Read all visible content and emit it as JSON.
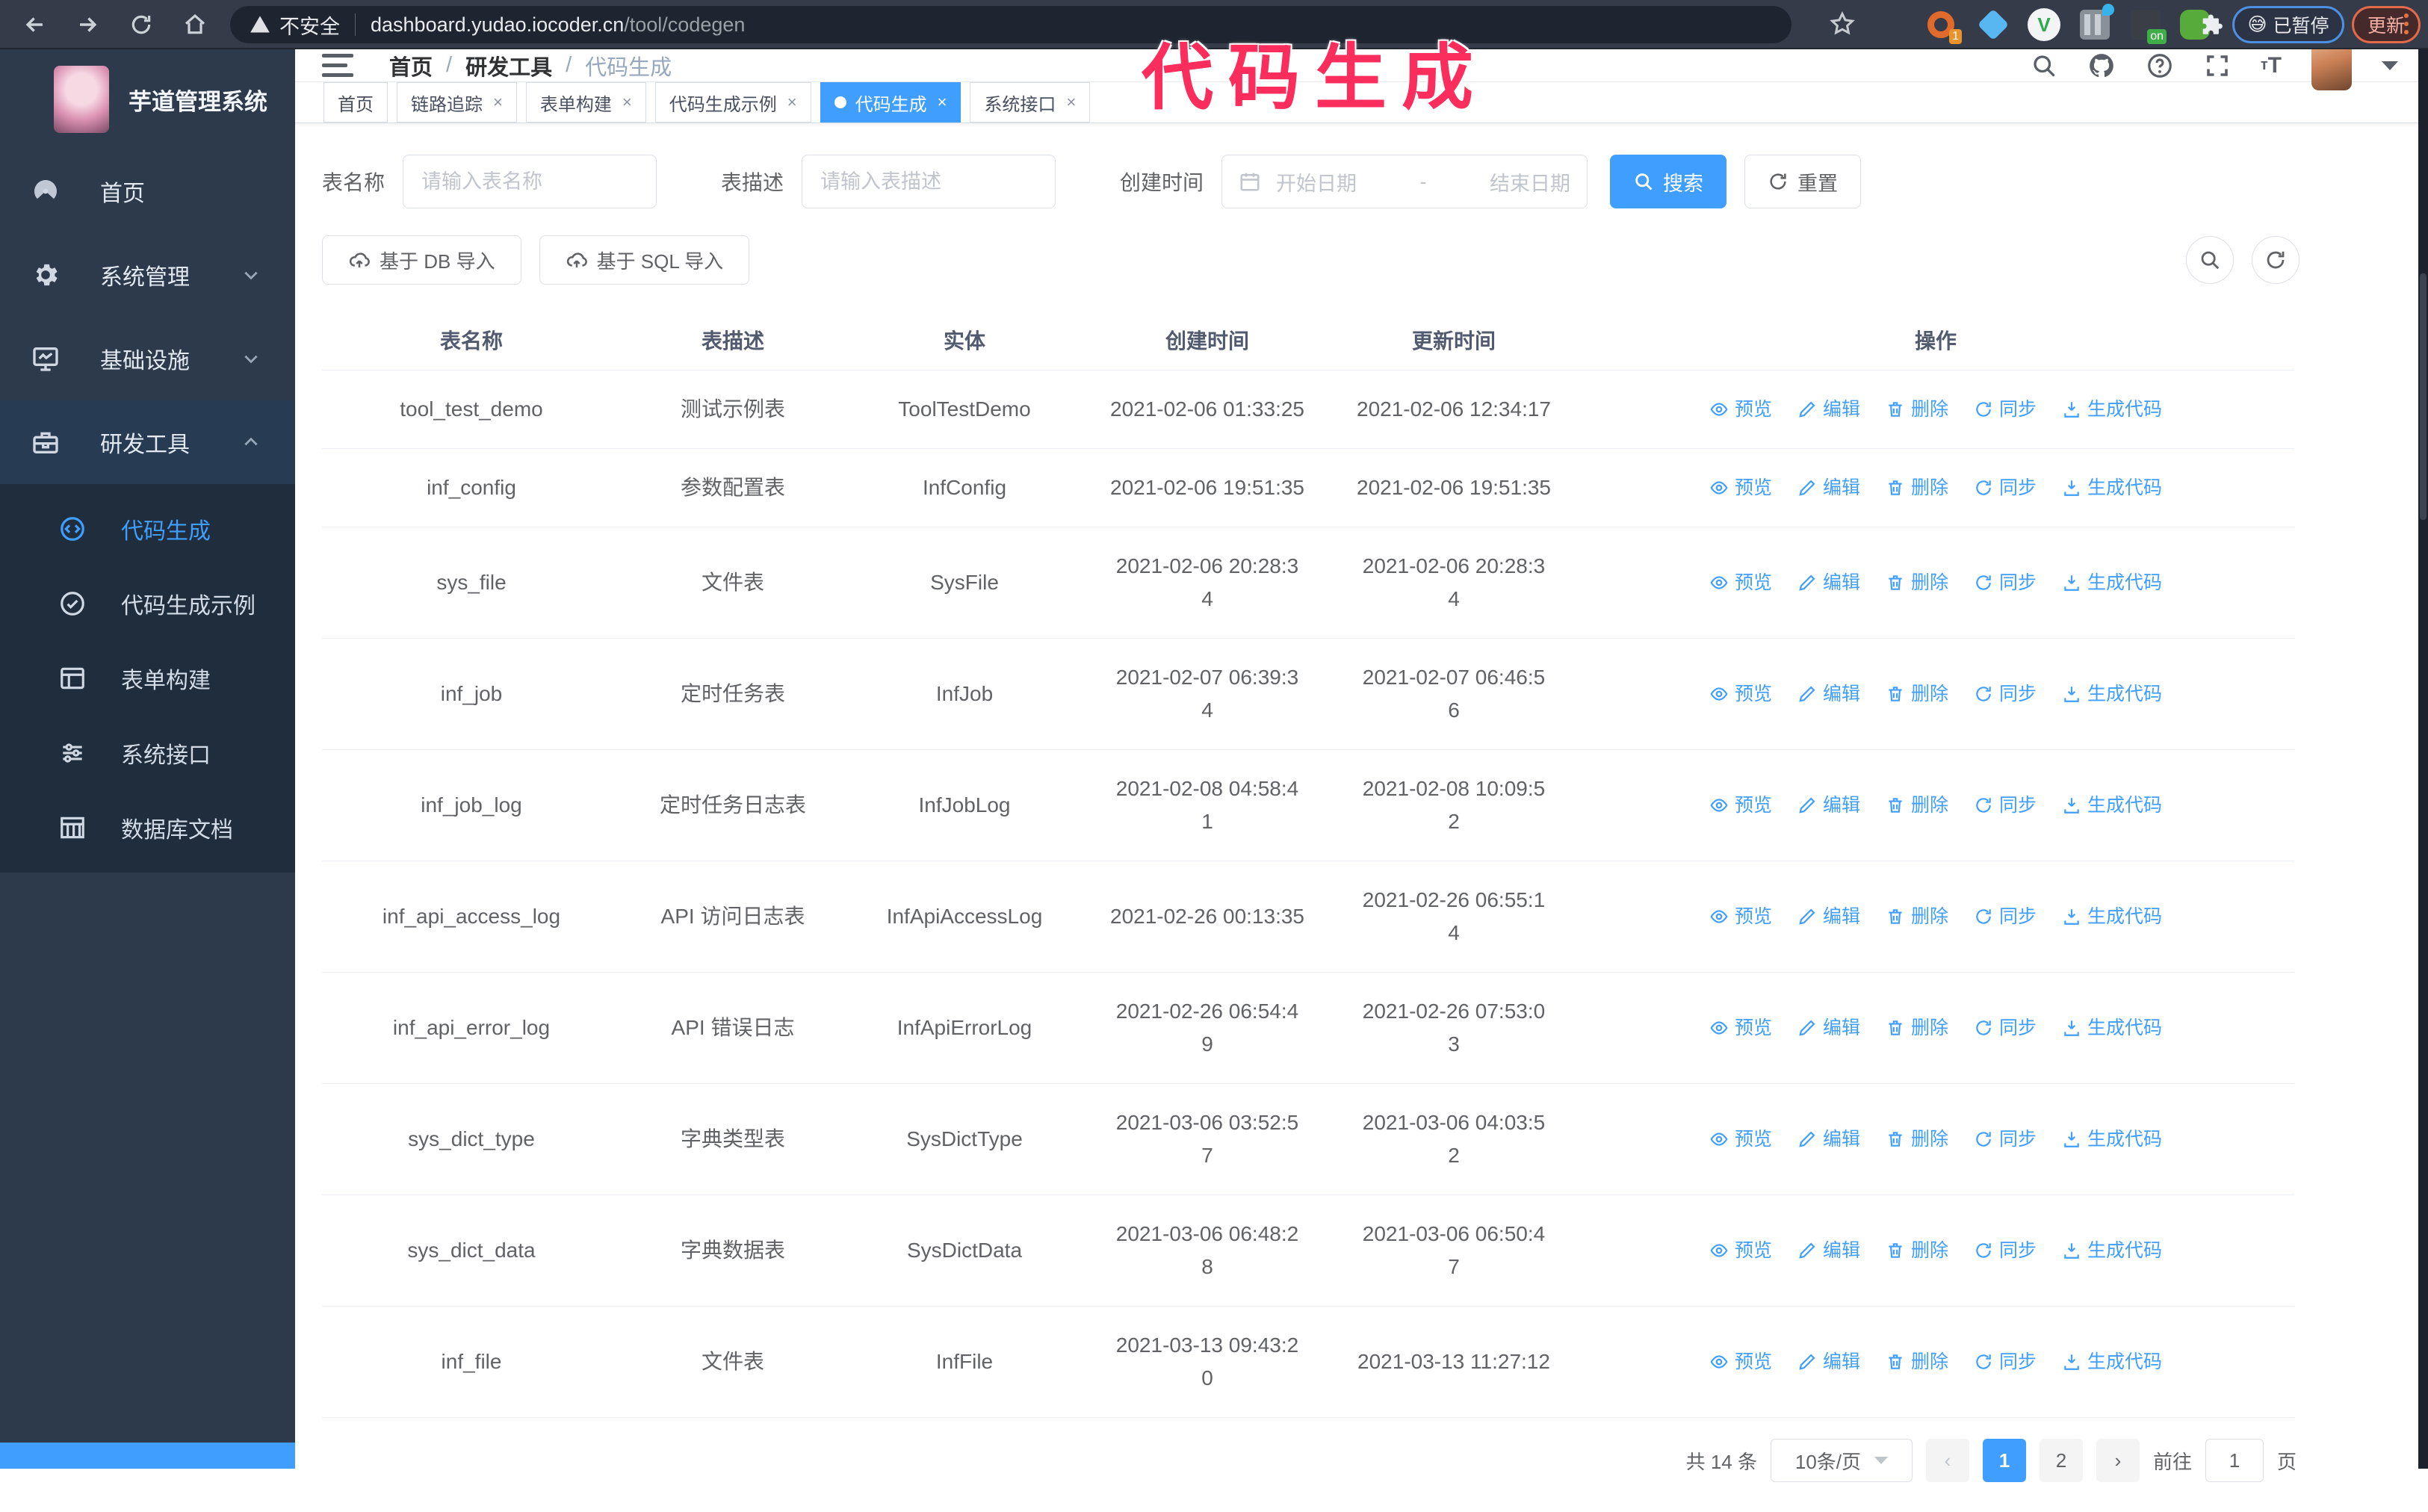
{
  "browser": {
    "security_label": "不安全",
    "url_domain": "dashboard.yudao.iocoder.cn",
    "url_path": "/tool/codegen",
    "extension_badge": "1",
    "extension_on_badge": "on",
    "paused_badge_emoji": "😅",
    "paused_badge": "已暂停",
    "update_button": "更新"
  },
  "annotation": {
    "title": "代码生成",
    "color": "#fb2d5c"
  },
  "sidebar": {
    "app_title": "芋道管理系统",
    "items": [
      {
        "label": "首页"
      },
      {
        "label": "系统管理"
      },
      {
        "label": "基础设施"
      },
      {
        "label": "研发工具"
      }
    ],
    "submenu": [
      {
        "label": "代码生成",
        "active": true
      },
      {
        "label": "代码生成示例"
      },
      {
        "label": "表单构建"
      },
      {
        "label": "系统接口"
      },
      {
        "label": "数据库文档"
      }
    ]
  },
  "header": {
    "breadcrumb": [
      "首页",
      "研发工具",
      "代码生成"
    ]
  },
  "tabs": [
    {
      "label": "首页",
      "closable": false,
      "active": false
    },
    {
      "label": "链路追踪",
      "closable": true,
      "active": false
    },
    {
      "label": "表单构建",
      "closable": true,
      "active": false
    },
    {
      "label": "代码生成示例",
      "closable": true,
      "active": false
    },
    {
      "label": "代码生成",
      "closable": true,
      "active": true
    },
    {
      "label": "系统接口",
      "closable": true,
      "active": false
    }
  ],
  "filters": {
    "table_name_label": "表名称",
    "table_name_placeholder": "请输入表名称",
    "table_desc_label": "表描述",
    "table_desc_placeholder": "请输入表描述",
    "create_time_label": "创建时间",
    "date_start_placeholder": "开始日期",
    "date_separator": "-",
    "date_end_placeholder": "结束日期",
    "search_label": "搜索",
    "reset_label": "重置"
  },
  "toolbar": {
    "import_db_label": "基于 DB 导入",
    "import_sql_label": "基于 SQL 导入"
  },
  "table": {
    "columns": [
      "表名称",
      "表描述",
      "实体",
      "创建时间",
      "更新时间",
      "操作"
    ],
    "actions": [
      "预览",
      "编辑",
      "删除",
      "同步",
      "生成代码"
    ],
    "rows": [
      {
        "name": "tool_test_demo",
        "desc": "测试示例表",
        "entity": "ToolTestDemo",
        "created": "2021-02-06 01:33:25",
        "updated": "2021-02-06 12:34:17"
      },
      {
        "name": "inf_config",
        "desc": "参数配置表",
        "entity": "InfConfig",
        "created": "2021-02-06 19:51:35",
        "updated": "2021-02-06 19:51:35"
      },
      {
        "name": "sys_file",
        "desc": "文件表",
        "entity": "SysFile",
        "created": "2021-02-06 20:28:3\n4",
        "updated": "2021-02-06 20:28:3\n4"
      },
      {
        "name": "inf_job",
        "desc": "定时任务表",
        "entity": "InfJob",
        "created": "2021-02-07 06:39:3\n4",
        "updated": "2021-02-07 06:46:5\n6"
      },
      {
        "name": "inf_job_log",
        "desc": "定时任务日志表",
        "entity": "InfJobLog",
        "created": "2021-02-08 04:58:4\n1",
        "updated": "2021-02-08 10:09:5\n2"
      },
      {
        "name": "inf_api_access_log",
        "desc": "API 访问日志表",
        "entity": "InfApiAccessLog",
        "created": "2021-02-26 00:13:35",
        "updated": "2021-02-26 06:55:1\n4"
      },
      {
        "name": "inf_api_error_log",
        "desc": "API 错误日志",
        "entity": "InfApiErrorLog",
        "created": "2021-02-26 06:54:4\n9",
        "updated": "2021-02-26 07:53:0\n3"
      },
      {
        "name": "sys_dict_type",
        "desc": "字典类型表",
        "entity": "SysDictType",
        "created": "2021-03-06 03:52:5\n7",
        "updated": "2021-03-06 04:03:5\n2"
      },
      {
        "name": "sys_dict_data",
        "desc": "字典数据表",
        "entity": "SysDictData",
        "created": "2021-03-06 06:48:2\n8",
        "updated": "2021-03-06 06:50:4\n7"
      },
      {
        "name": "inf_file",
        "desc": "文件表",
        "entity": "InfFile",
        "created": "2021-03-13 09:43:2\n0",
        "updated": "2021-03-13 11:27:12"
      }
    ]
  },
  "pagination": {
    "total_label": "共 14 条",
    "page_size": "10条/页",
    "pages": [
      "1",
      "2"
    ],
    "active_page": "1",
    "goto_label": "前往",
    "goto_value": "1",
    "goto_suffix": "页"
  }
}
